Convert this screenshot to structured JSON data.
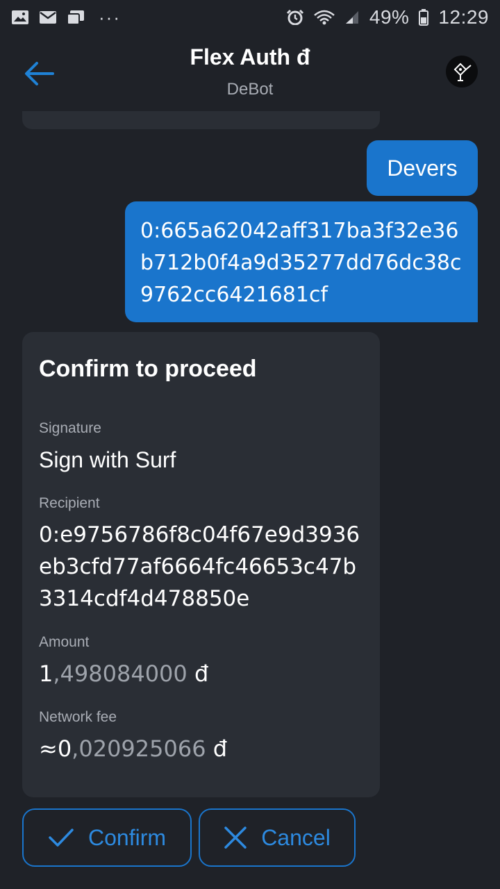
{
  "status_bar": {
    "battery": "49%",
    "time": "12:29",
    "dots": "···"
  },
  "header": {
    "title": "Flex Auth đ",
    "subtitle": "DeBot"
  },
  "messages": {
    "out_1": "Devers",
    "out_2": "0:665a62042aff317ba3f32e36b712b0f4a9d35277dd76dc38c9762cc6421681cf"
  },
  "confirm_card": {
    "title": "Confirm to proceed",
    "signature_label": "Signature",
    "signature_value": "Sign with Surf",
    "recipient_label": "Recipient",
    "recipient_value": "0:e9756786f8c04f67e9d3936eb3cfd77af6664fc46653c47b3314cdf4d478850e",
    "amount_label": "Amount",
    "amount_int": "1",
    "amount_frac": ",498084000",
    "amount_unit": " đ",
    "fee_label": "Network fee",
    "fee_int": "≈0",
    "fee_frac": ",020925066",
    "fee_unit": " đ"
  },
  "actions": {
    "confirm_label": "Confirm",
    "cancel_label": "Cancel"
  },
  "colors": {
    "background": "#1f2228",
    "card": "#2a2e35",
    "accent": "#1a75cc"
  }
}
